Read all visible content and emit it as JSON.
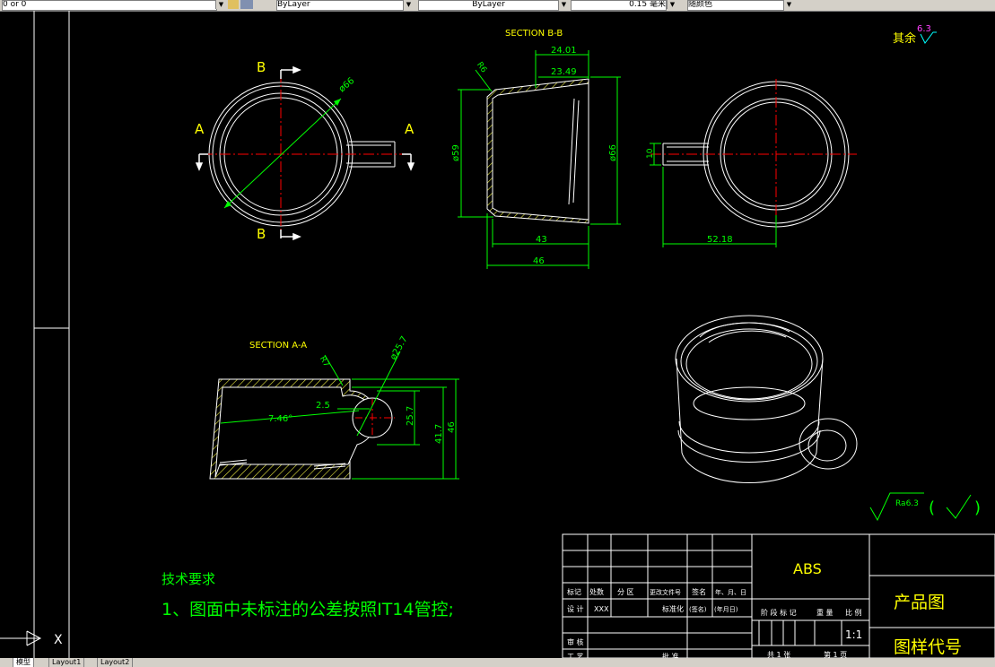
{
  "toolbar": {
    "layer_value": "0 or 0",
    "color_value": "ByLayer",
    "linetype_value": "ByLayer",
    "lineweight_value": "0.15 毫米",
    "plotstyle_value": "随颜色"
  },
  "drawing": {
    "section_bb_title": "SECTION B-B",
    "section_aa_title": "SECTION A-A",
    "label_b": "B",
    "label_a": "A",
    "dim_phi66": "ø66",
    "dim_24_01": "24.01",
    "dim_23_49": "23.49",
    "dim_r6": "R6",
    "dim_phi59": "ø59",
    "dim_phi66_v": "ø66",
    "dim_43": "43",
    "dim_46": "46",
    "dim_10": "10",
    "dim_52_18": "52.18",
    "dim_r7": "R7",
    "dim_phi25_7": "ø25.7",
    "dim_2_5": "2.5",
    "dim_7_46": "7.46°",
    "dim_25_7": "25.7",
    "dim_41_7": "41.7",
    "dim_46_v": "46",
    "roughness_rest": "其余",
    "roughness_value": "6.3",
    "roughness_ra": "Ra6.3",
    "tech_req_title": "技术要求",
    "tech_req_line1": "1、图面中未标注的公差按照IT14管控;"
  },
  "title_block": {
    "material": "ABS",
    "title_label": "产品图",
    "drawing_no_label": "图样代号",
    "col_mark": "标记",
    "col_count": "处数",
    "col_zone": "分 区",
    "col_change_doc": "更改文件号",
    "col_sign": "签名",
    "col_date": "年、月、日",
    "row_design": "设 计",
    "designer": "XXX",
    "row_standard": "标准化",
    "sign_placeholder": "(签名)",
    "date_placeholder": "(年月日)",
    "stage_mark": "阶 段 标 记",
    "weight": "重 量",
    "scale_label": "比 例",
    "scale_value": "1:1",
    "row_review": "审 核",
    "row_craft": "工 艺",
    "row_approve": "批 准",
    "sheets_total": "共 1 张",
    "sheet_no": "第 1 页"
  },
  "layout_tabs": [
    "模型",
    "Layout1",
    "Layout2"
  ],
  "colors": {
    "background": "#000000",
    "line": "#ffffff",
    "dim": "#00ff00",
    "center": "#ff0000",
    "hatch": "#ffff00",
    "title": "#ffff00"
  }
}
